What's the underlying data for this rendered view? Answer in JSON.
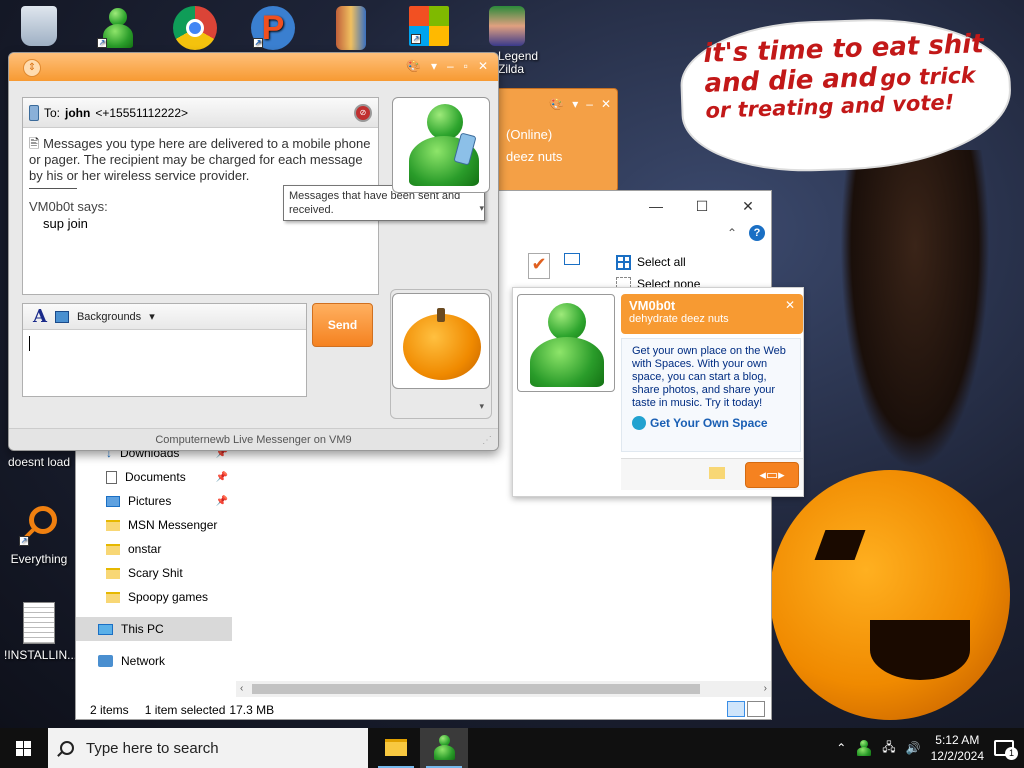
{
  "desktop": {
    "icons": [
      {
        "label": "",
        "name": "recycle-bin-icon"
      },
      {
        "label": "",
        "name": "msn-shortcut-icon"
      },
      {
        "label": "",
        "name": "chrome-icon"
      },
      {
        "label": "",
        "name": "p-app-icon"
      },
      {
        "label": "",
        "name": "archive-icon"
      },
      {
        "label": "",
        "name": "windows-logo-icon"
      },
      {
        "label": "Legend\nZilda",
        "name": "zelda-game-icon"
      },
      {
        "label": "doesnt load",
        "name": "doesnt-load-icon"
      },
      {
        "label": "Everything",
        "name": "everything-search-icon"
      },
      {
        "label": "!INSTALLIN...",
        "name": "text-file-icon"
      }
    ],
    "bubble": {
      "line1": "it's time to eat shit",
      "line2a": "and die and",
      "line2b": "go trick",
      "line3": "or treating and vote!"
    }
  },
  "explorer": {
    "controls": {
      "minimize": "—",
      "maximize": "☐",
      "close": "✕"
    },
    "ribbon": {
      "select_all": "Select all",
      "select_none": "Select none"
    },
    "nav_items": [
      {
        "label": "Downloads",
        "icon": "download-icon",
        "pinned": true
      },
      {
        "label": "Documents",
        "icon": "documents-icon",
        "pinned": true
      },
      {
        "label": "Pictures",
        "icon": "pictures-icon",
        "pinned": true
      },
      {
        "label": "MSN Messenger",
        "icon": "folder-icon",
        "pinned": false
      },
      {
        "label": "onstar",
        "icon": "folder-icon",
        "pinned": false
      },
      {
        "label": "Scary Shit",
        "icon": "folder-icon",
        "pinned": false
      },
      {
        "label": "Spoopy games",
        "icon": "folder-icon",
        "pinned": false
      }
    ],
    "this_pc": "This PC",
    "network": "Network",
    "status": {
      "items": "2 items",
      "selected": "1 item selected",
      "size": "17.3 MB"
    }
  },
  "bg_messenger": {
    "status": "(Online)",
    "message": "deez nuts"
  },
  "contact_card": {
    "name": "VM0b0t",
    "status_message": "dehydrate deez nuts",
    "body": "Get your own place on the Web with Spaces. With your own space, you can start a blog, share photos, and share your taste in music. Try it today!",
    "link": "Get Your Own Space"
  },
  "messenger": {
    "to_label": "To:",
    "to_name": "john",
    "to_number": "<+15551112222>",
    "notice": "Messages you type here are delivered to a mobile phone or pager. The recipient may be charged for each message by his or her wireless service provider.",
    "sender": "VM0b0t says:",
    "message": "sup join",
    "tooltip": "Messages that have been sent and received.",
    "backgrounds": "Backgrounds",
    "send": "Send",
    "status_bar": "Computernewb Live Messenger on VM9",
    "accent": "#f79a32"
  },
  "taskbar": {
    "search_placeholder": "Type here to search",
    "time": "5:12 AM",
    "date": "12/2/2024",
    "notifications": "1"
  }
}
